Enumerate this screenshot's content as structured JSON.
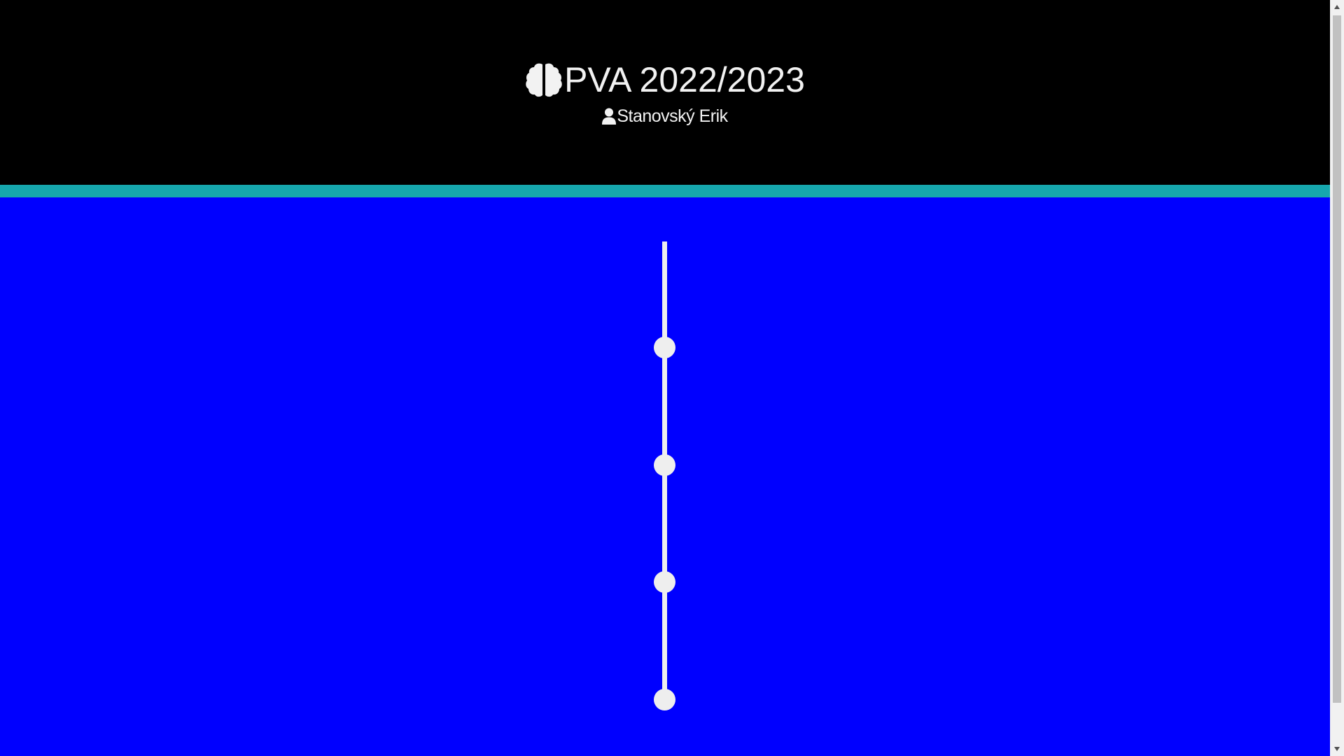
{
  "header": {
    "title": "PVA 2022/2023",
    "title_icon": "brain-icon",
    "author": "Stanovský Erik",
    "author_icon": "user-icon"
  },
  "timeline": {
    "items": [
      {
        "index": 1
      },
      {
        "index": 2
      },
      {
        "index": 3
      },
      {
        "index": 4
      }
    ]
  },
  "colors": {
    "header_bg": "#000000",
    "accent": "#16a7ad",
    "page_bg": "#0000ff",
    "timeline": "#eeeeee",
    "text": "#f2f2f2"
  },
  "scrollbar": {
    "up_icon": "scroll-up-arrow-icon",
    "down_icon": "scroll-down-arrow-icon"
  }
}
